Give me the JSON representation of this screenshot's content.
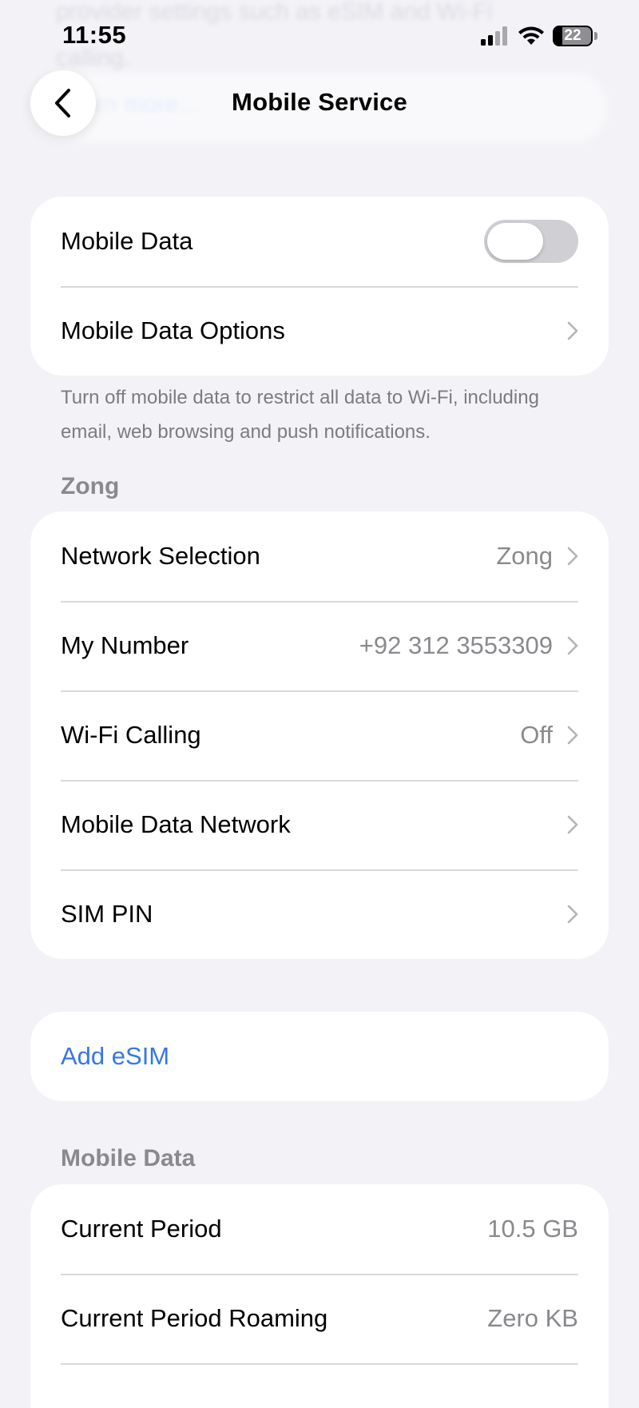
{
  "status": {
    "time": "11:55",
    "battery": "22"
  },
  "background_text": {
    "line1": "provider settings such as eSIM and Wi-Fi",
    "line2": "calling.",
    "line3": "Learn more..."
  },
  "nav": {
    "title": "Mobile Service"
  },
  "mobile_data_group": {
    "mobile_data_label": "Mobile Data",
    "mobile_data_on": false,
    "options_label": "Mobile Data Options"
  },
  "footnote": "Turn off mobile data to restrict all data to Wi-Fi, including email, web browsing and push notifications.",
  "carrier_section": {
    "header": "Zong",
    "rows": [
      {
        "label": "Network Selection",
        "value": "Zong"
      },
      {
        "label": "My Number",
        "value": "+92 312 3553309"
      },
      {
        "label": "Wi-Fi Calling",
        "value": "Off"
      },
      {
        "label": "Mobile Data Network",
        "value": ""
      },
      {
        "label": "SIM PIN",
        "value": ""
      }
    ]
  },
  "esim": {
    "label": "Add eSIM"
  },
  "usage_section": {
    "header": "Mobile Data",
    "rows": [
      {
        "label": "Current Period",
        "value": "10.5 GB"
      },
      {
        "label": "Current Period Roaming",
        "value": "Zero KB"
      }
    ]
  },
  "colors": {
    "background": "#f2f2f7",
    "link": "#3478e5",
    "secondary_text": "#8a8a8e",
    "toggle_off": "#cfcfd4"
  },
  "icons": {
    "back": "chevron-left-icon",
    "row": "chevron-right-icon",
    "signal": "cellular-signal-icon",
    "wifi": "wifi-icon",
    "battery": "battery-icon"
  }
}
